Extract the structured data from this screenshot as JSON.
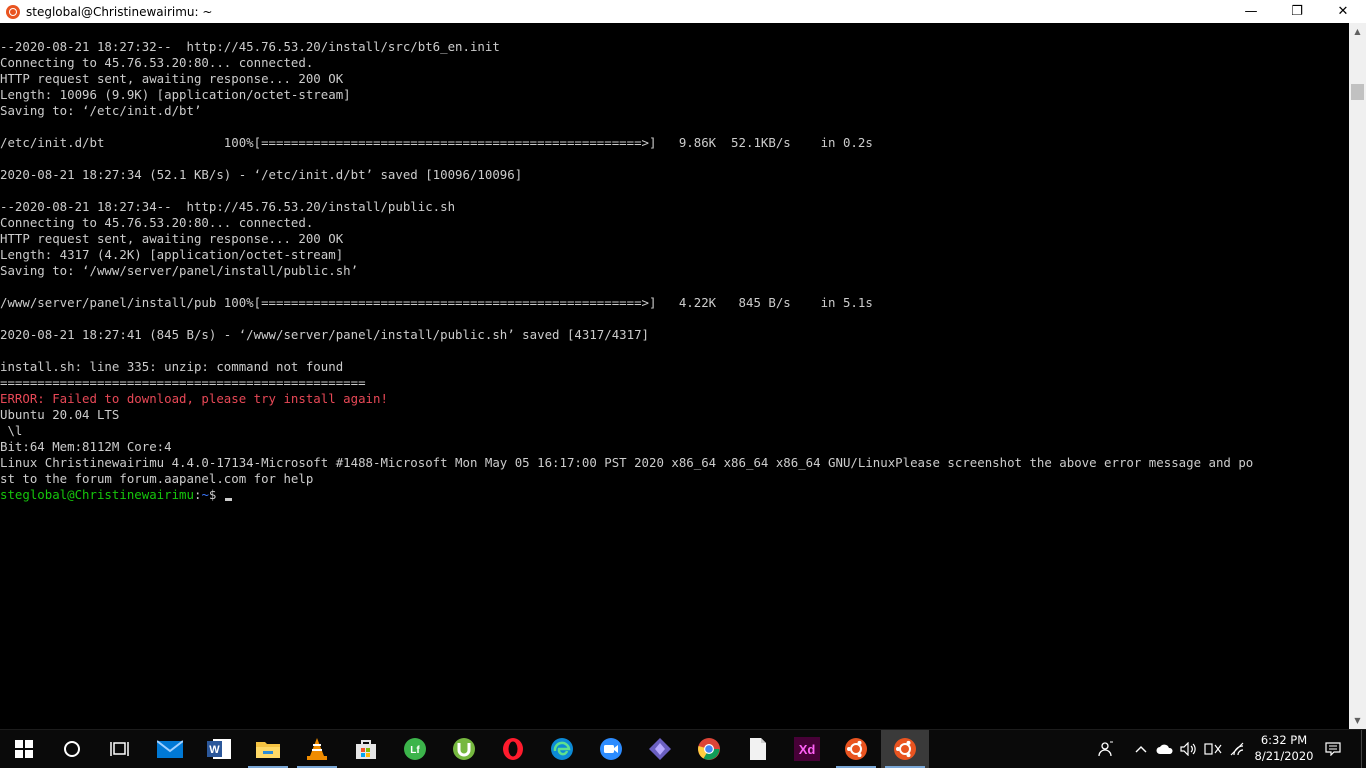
{
  "window": {
    "title": "steglobal@Christinewairimu: ~",
    "minimize_glyph": "—",
    "maximize_glyph": "❐",
    "close_glyph": "✕"
  },
  "terminal": {
    "lines": [
      {
        "text": "--2020-08-21 18:27:32--  http://45.76.53.20/install/src/bt6_en.init",
        "type": "normal"
      },
      {
        "text": "Connecting to 45.76.53.20:80... connected.",
        "type": "normal"
      },
      {
        "text": "HTTP request sent, awaiting response... 200 OK",
        "type": "normal"
      },
      {
        "text": "Length: 10096 (9.9K) [application/octet-stream]",
        "type": "normal"
      },
      {
        "text": "Saving to: ‘/etc/init.d/bt’",
        "type": "normal"
      },
      {
        "text": "",
        "type": "normal"
      },
      {
        "text": "/etc/init.d/bt                100%[===================================================>]   9.86K  52.1KB/s    in 0.2s",
        "type": "normal"
      },
      {
        "text": "",
        "type": "normal"
      },
      {
        "text": "2020-08-21 18:27:34 (52.1 KB/s) - ‘/etc/init.d/bt’ saved [10096/10096]",
        "type": "normal"
      },
      {
        "text": "",
        "type": "normal"
      },
      {
        "text": "--2020-08-21 18:27:34--  http://45.76.53.20/install/public.sh",
        "type": "normal"
      },
      {
        "text": "Connecting to 45.76.53.20:80... connected.",
        "type": "normal"
      },
      {
        "text": "HTTP request sent, awaiting response... 200 OK",
        "type": "normal"
      },
      {
        "text": "Length: 4317 (4.2K) [application/octet-stream]",
        "type": "normal"
      },
      {
        "text": "Saving to: ‘/www/server/panel/install/public.sh’",
        "type": "normal"
      },
      {
        "text": "",
        "type": "normal"
      },
      {
        "text": "/www/server/panel/install/pub 100%[===================================================>]   4.22K   845 B/s    in 5.1s",
        "type": "normal"
      },
      {
        "text": "",
        "type": "normal"
      },
      {
        "text": "2020-08-21 18:27:41 (845 B/s) - ‘/www/server/panel/install/public.sh’ saved [4317/4317]",
        "type": "normal"
      },
      {
        "text": "",
        "type": "normal"
      },
      {
        "text": "install.sh: line 335: unzip: command not found",
        "type": "normal"
      },
      {
        "text": "=================================================",
        "type": "normal"
      },
      {
        "text": "ERROR: Failed to download, please try install again!",
        "type": "error"
      },
      {
        "text": "Ubuntu 20.04 LTS",
        "type": "normal"
      },
      {
        "text": " \\l",
        "type": "normal"
      },
      {
        "text": "Bit:64 Mem:8112M Core:4",
        "type": "normal"
      },
      {
        "text": "Linux Christinewairimu 4.4.0-17134-Microsoft #1488-Microsoft Mon May 05 16:17:00 PST 2020 x86_64 x86_64 x86_64 GNU/LinuxPlease screenshot the above error message and po",
        "type": "normal"
      },
      {
        "text": "st to the forum forum.aapanel.com for help",
        "type": "normal"
      }
    ],
    "prompt": {
      "user_host": "steglobal@Christinewairimu",
      "colon": ":",
      "path": "~",
      "symbol": "$ "
    }
  },
  "scrollbar": {
    "up_glyph": "▲",
    "down_glyph": "▼"
  },
  "taskbar": {
    "apps": [
      {
        "name": "start-button",
        "icon": "windows-logo-icon"
      },
      {
        "name": "search-button",
        "icon": "search-circle-icon"
      },
      {
        "name": "task-view-button",
        "icon": "task-view-icon"
      },
      {
        "name": "taskbar-mail",
        "icon": "mail-icon"
      },
      {
        "name": "taskbar-word",
        "icon": "word-icon",
        "label": "W"
      },
      {
        "name": "taskbar-file-explorer",
        "icon": "folder-icon"
      },
      {
        "name": "taskbar-vlc",
        "icon": "vlc-cone-icon"
      },
      {
        "name": "taskbar-store",
        "icon": "store-bag-icon"
      },
      {
        "name": "taskbar-lf",
        "icon": "lf-icon",
        "label": "Lf"
      },
      {
        "name": "taskbar-utorrent",
        "icon": "utorrent-icon"
      },
      {
        "name": "taskbar-opera",
        "icon": "opera-icon"
      },
      {
        "name": "taskbar-edge",
        "icon": "edge-icon"
      },
      {
        "name": "taskbar-zoom",
        "icon": "zoom-icon"
      },
      {
        "name": "taskbar-app-diamond",
        "icon": "diamond-app-icon"
      },
      {
        "name": "taskbar-chrome",
        "icon": "chrome-icon"
      },
      {
        "name": "taskbar-document",
        "icon": "document-icon"
      },
      {
        "name": "taskbar-adobe-xd",
        "icon": "adobe-xd-icon",
        "label": "Xd"
      },
      {
        "name": "taskbar-ubuntu",
        "icon": "ubuntu-icon"
      },
      {
        "name": "taskbar-ubuntu-active",
        "icon": "ubuntu-icon"
      }
    ],
    "tray": {
      "clock_time": "6:32 PM",
      "clock_date": "8/21/2020"
    },
    "colors": {
      "ubuntu_orange": "#e95420",
      "error_red": "#e74856",
      "prompt_green": "#16c60c",
      "prompt_blue": "#3b78ff"
    }
  }
}
